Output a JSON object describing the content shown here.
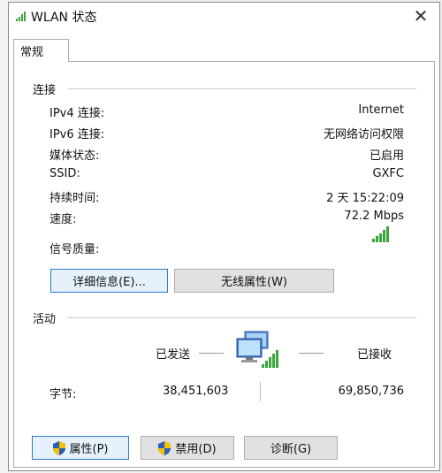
{
  "window": {
    "title": "WLAN 状态",
    "close_glyph": "✕"
  },
  "tabs": [
    {
      "label": "常规"
    }
  ],
  "connection": {
    "title": "连接",
    "rows": [
      {
        "label": "IPv4 连接:",
        "value": "Internet"
      },
      {
        "label": "IPv6 连接:",
        "value": "无网络访问权限"
      },
      {
        "label": "媒体状态:",
        "value": "已启用"
      },
      {
        "label": "SSID:",
        "value": "GXFC"
      },
      {
        "label": "持续时间:",
        "value": "2 天 15:22:09"
      },
      {
        "label": "速度:",
        "value": "72.2 Mbps"
      }
    ],
    "signal_label": "信号质量:",
    "signal_bars": 5,
    "details_button": "详细信息(E)...",
    "wireless_button": "无线属性(W)"
  },
  "activity": {
    "title": "活动",
    "sent_label": "已发送",
    "received_label": "已接收",
    "bytes_label": "字节:",
    "bytes_sent": "38,451,603",
    "bytes_received": "69,850,736"
  },
  "footer": {
    "properties_button": "属性(P)",
    "disable_button": "禁用(D)",
    "diagnose_button": "诊断(G)"
  },
  "colors": {
    "accent": "#2d78d8",
    "signal": "#3aa53a"
  }
}
